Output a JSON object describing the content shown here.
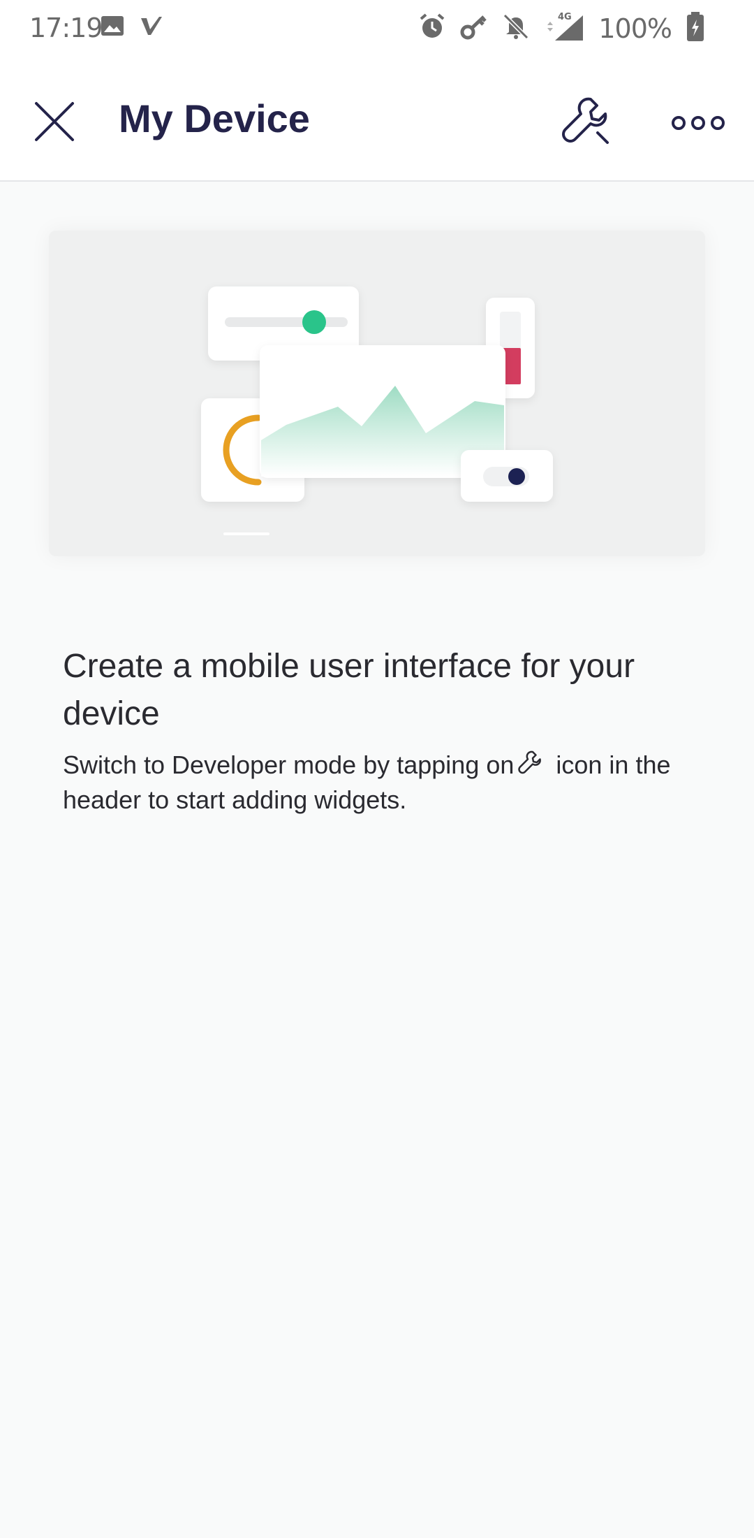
{
  "status_bar": {
    "time": "17:19",
    "battery": "100%",
    "network": "4G",
    "left_icons": [
      "image-icon",
      "v-app-icon"
    ],
    "right_icons": [
      "alarm-icon",
      "key-icon",
      "bell-off-icon",
      "signal-icon",
      "battery-charging-icon"
    ]
  },
  "app_bar": {
    "title": "My Device",
    "icons": [
      "close-icon",
      "wrench-icon",
      "more-icon"
    ]
  },
  "empty_state": {
    "heading": "Create a mobile user interface for your device",
    "description_before_icon": "Switch to Developer mode by tapping on",
    "description_icon": "wrench-icon",
    "description_after_icon": " icon in the header to start adding widgets."
  },
  "colors": {
    "title": "#24234a",
    "accent_green": "#2bc48a",
    "accent_red": "#d33c5e",
    "accent_orange": "#e8a020",
    "accent_navy": "#1f2052"
  }
}
